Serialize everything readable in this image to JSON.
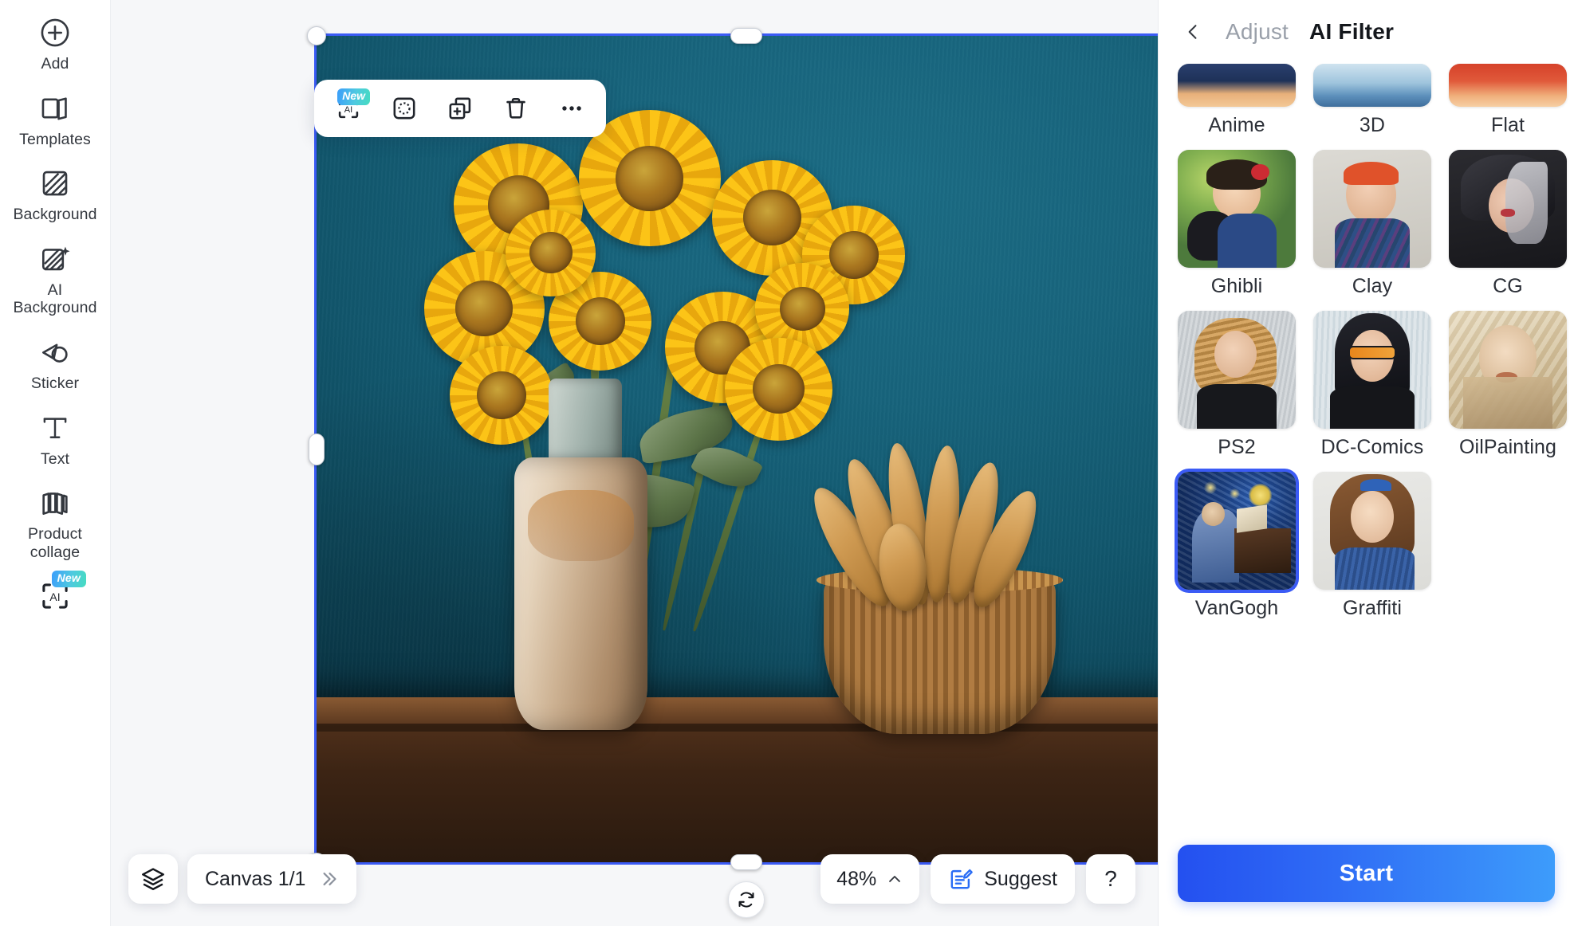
{
  "sidebar": {
    "items": [
      {
        "label": "Add",
        "icon": "plus-circle-icon",
        "badge": null
      },
      {
        "label": "Templates",
        "icon": "templates-icon",
        "badge": null
      },
      {
        "label": "Background",
        "icon": "background-hatch-icon",
        "badge": null
      },
      {
        "label": "AI\nBackground",
        "label_line1": "AI",
        "label_line2": "Background",
        "icon": "ai-background-icon",
        "badge": null
      },
      {
        "label": "Sticker",
        "icon": "sticker-icon",
        "badge": null
      },
      {
        "label": "Text",
        "icon": "text-icon",
        "badge": null
      },
      {
        "label": "Product\ncollage",
        "label_line1": "Product",
        "label_line2": "collage",
        "icon": "product-collage-icon",
        "badge": null
      },
      {
        "label": "",
        "icon": "ai-scan-icon",
        "badge": "New"
      }
    ]
  },
  "object_toolbar": {
    "buttons": [
      {
        "name": "ai-tool",
        "label": "AI",
        "badge": "New",
        "icon": "ai-scan-icon"
      },
      {
        "name": "cutout-tool",
        "label": "",
        "badge": null,
        "icon": "cutout-icon"
      },
      {
        "name": "duplicate-tool",
        "label": "",
        "badge": null,
        "icon": "duplicate-icon"
      },
      {
        "name": "delete-tool",
        "label": "",
        "badge": null,
        "icon": "trash-icon"
      },
      {
        "name": "more-tool",
        "label": "",
        "badge": null,
        "icon": "more-horizontal-icon"
      }
    ]
  },
  "bottom_bar": {
    "layers_icon": "layers-icon",
    "canvas_label": "Canvas 1/1",
    "canvas_expand_icon": "double-chevron-right-icon",
    "zoom_value": "48%",
    "zoom_chevron_icon": "chevron-up-icon",
    "suggest_label": "Suggest",
    "suggest_icon": "suggest-edit-icon",
    "help_label": "?",
    "rotate_icon": "rotate-icon"
  },
  "right_panel": {
    "back_icon": "chevron-left-icon",
    "tabs": [
      {
        "label": "Adjust",
        "active": false
      },
      {
        "label": "AI Filter",
        "active": true
      }
    ],
    "start_label": "Start",
    "partial_row_labels": [
      "Anime",
      "3D",
      "Flat"
    ],
    "filters": [
      {
        "label": "Ghibli",
        "selected": false
      },
      {
        "label": "Clay",
        "selected": false
      },
      {
        "label": "CG",
        "selected": false
      },
      {
        "label": "PS2",
        "selected": false
      },
      {
        "label": "DC-Comics",
        "selected": false
      },
      {
        "label": "OilPainting",
        "selected": false
      },
      {
        "label": "VanGogh",
        "selected": true
      },
      {
        "label": "Graffiti",
        "selected": false
      }
    ]
  },
  "colors": {
    "accent_blue": "#3b5bf5",
    "start_gradient_from": "#2450f0",
    "start_gradient_to": "#3d9cfb",
    "badge_gradient_from": "#3b9dfb",
    "badge_gradient_to": "#46dcc0",
    "canvas_bg": "#0e4a5e"
  }
}
